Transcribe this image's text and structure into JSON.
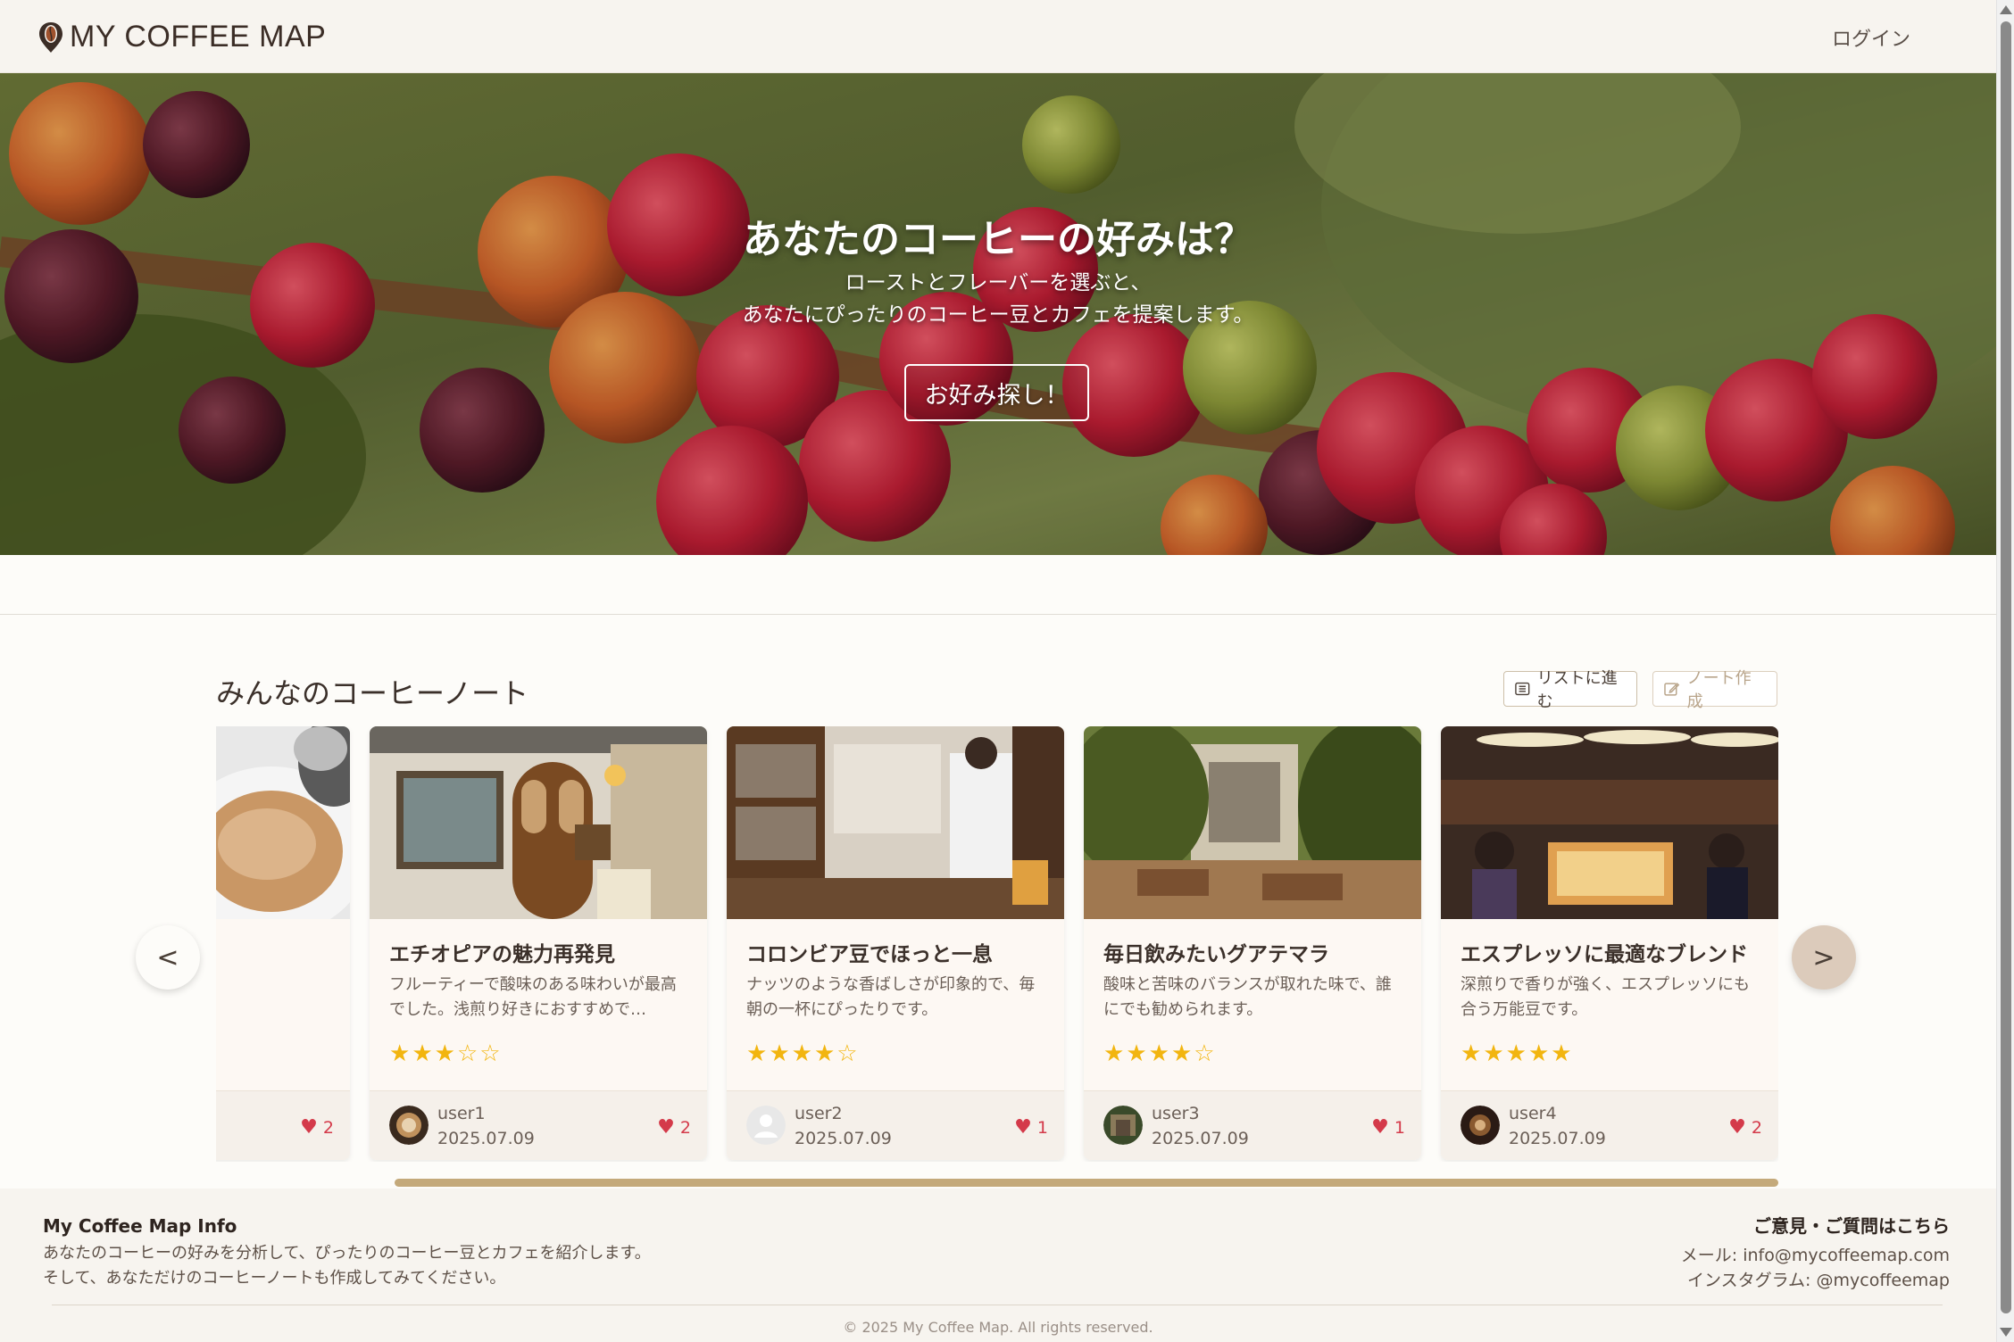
{
  "header": {
    "logo_text": "MY COFFEE MAP",
    "login_label": "ログイン"
  },
  "hero": {
    "title": "あなたのコーヒーの好みは？",
    "subtitle_line1": "ローストとフレーバーを選ぶと、",
    "subtitle_line2": "あなたにぴったりのコーヒー豆とカフェを提案します。",
    "cta_label": "お好み探し！"
  },
  "notes": {
    "title": "みんなのコーヒーノート",
    "list_button": "リストに進む",
    "create_button": "ノート作成",
    "prev_label": "<",
    "next_label": ">",
    "cards": [
      {
        "title": "",
        "desc": "",
        "rating": 0,
        "user": "",
        "date": "",
        "likes": "2"
      },
      {
        "title": "エチオピアの魅力再発見",
        "desc": "フルーティーで酸味のある味わいが最高でした。浅煎り好きにおすすめで…",
        "rating": 3,
        "user": "user1",
        "date": "2025.07.09",
        "likes": "2"
      },
      {
        "title": "コロンビア豆でほっと一息",
        "desc": "ナッツのような香ばしさが印象的で、毎朝の一杯にぴったりです。",
        "rating": 4,
        "user": "user2",
        "date": "2025.07.09",
        "likes": "1"
      },
      {
        "title": "毎日飲みたいグアテマラ",
        "desc": "酸味と苦味のバランスが取れた味で、誰にでも勧められます。",
        "rating": 4,
        "user": "user3",
        "date": "2025.07.09",
        "likes": "1"
      },
      {
        "title": "エスプレッソに最適なブレンド",
        "desc": "深煎りで香りが強く、エスプレッソにも合う万能豆です。",
        "rating": 5,
        "user": "user4",
        "date": "2025.07.09",
        "likes": "2"
      }
    ]
  },
  "footer": {
    "info_title": "My Coffee Map Info",
    "info_line1": "あなたのコーヒーの好みを分析して、ぴったりのコーヒー豆とカフェを紹介します。",
    "info_line2": "そして、あなただけのコーヒーノートも作成してみてください。",
    "contact_title": "ご意見・ご質問はこちら",
    "mail": "メール: info@mycoffeemap.com",
    "instagram": "インスタグラム: @mycoffeemap",
    "copyright": "© 2025 My Coffee Map. All rights reserved."
  },
  "colors": {
    "accent": "#c4a97a",
    "star": "#f2b50f",
    "heart": "#d43a4a",
    "header_bg": "#f7f4ef"
  },
  "icons": {
    "logo": "coffee-bean-pin-icon",
    "list": "list-icon",
    "create": "edit-icon",
    "like": "heart-icon",
    "rating": "star-icon"
  }
}
